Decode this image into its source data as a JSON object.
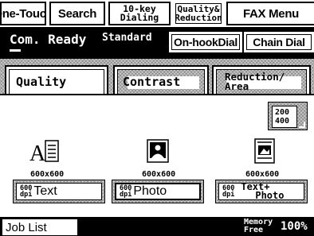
{
  "menu_tabs": {
    "one_touch": "One-Touch",
    "search": "Search",
    "tenkey_line1": "10-key",
    "tenkey_line2": "Dialing",
    "quality_line1": "Quality&",
    "quality_line2": "Reduction",
    "fax_menu": "FAX Menu"
  },
  "status": {
    "text": "Com. Ready",
    "mode": "Standard",
    "onhook_label": "On-hookDial",
    "chain_label": "Chain Dial"
  },
  "sub_tabs": {
    "quality": "Quality",
    "contrast": "Contrast",
    "reduction_line1": "Reduction/",
    "reduction_line2": "Area"
  },
  "resolution_button": {
    "line1": "200",
    "line2": "400"
  },
  "quality_options": [
    {
      "resolution": "600x600",
      "dpi_top": "600",
      "dpi_bottom": "dpi",
      "label": "Text",
      "icon": "text-page-icon"
    },
    {
      "resolution": "600x600",
      "dpi_top": "600",
      "dpi_bottom": "dpi",
      "label": "Photo",
      "icon": "photo-icon"
    },
    {
      "resolution": "600x600",
      "dpi_top": "600",
      "dpi_bottom": "dpi",
      "label_line1": "Text+",
      "label_line2": "Photo",
      "icon": "text-photo-icon"
    }
  ],
  "bottom": {
    "job_list": "Job List",
    "memory_line1": "Memory",
    "memory_line2": "Free",
    "memory_value": "100%"
  }
}
